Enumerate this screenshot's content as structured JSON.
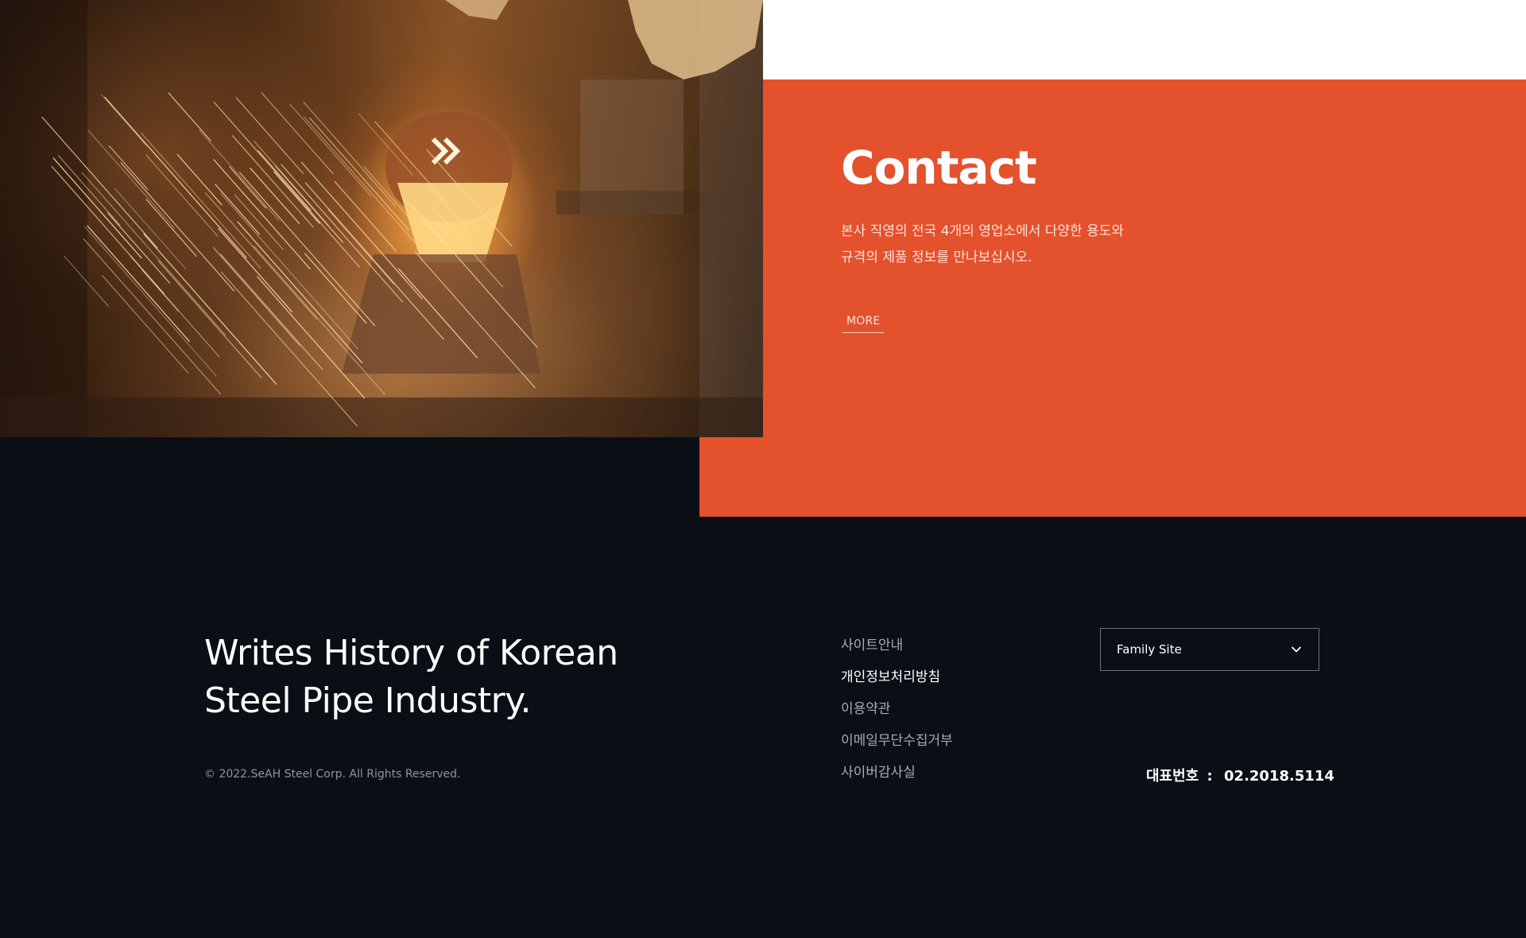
{
  "contact": {
    "title": "Contact",
    "description_line1": "본사 직영의 전국 4개의 영업소에서 다양한 용도와",
    "description_line2": "규격의 제품 정보를 만나보십시오.",
    "more_label": "MORE"
  },
  "footer": {
    "tagline_line1": "Writes History of Korean",
    "tagline_line2": "Steel Pipe Industry.",
    "copyright": "© 2022.SeAH Steel Corp. All Rights Reserved.",
    "links": [
      {
        "label": "사이트안내"
      },
      {
        "label": "개인정보처리방침"
      },
      {
        "label": "이용약관"
      },
      {
        "label": "이메일무단수집거부"
      },
      {
        "label": "사이버감사실"
      }
    ],
    "family_site": {
      "label": "Family Site",
      "icon": "chevron-down-icon"
    },
    "phone": {
      "label": "대표번호",
      "separator": ":",
      "number": "02.2018.5114"
    }
  },
  "colors": {
    "accent": "#e4512d",
    "footer_bg": "#0a0f16",
    "top_white": "#ffffff"
  }
}
